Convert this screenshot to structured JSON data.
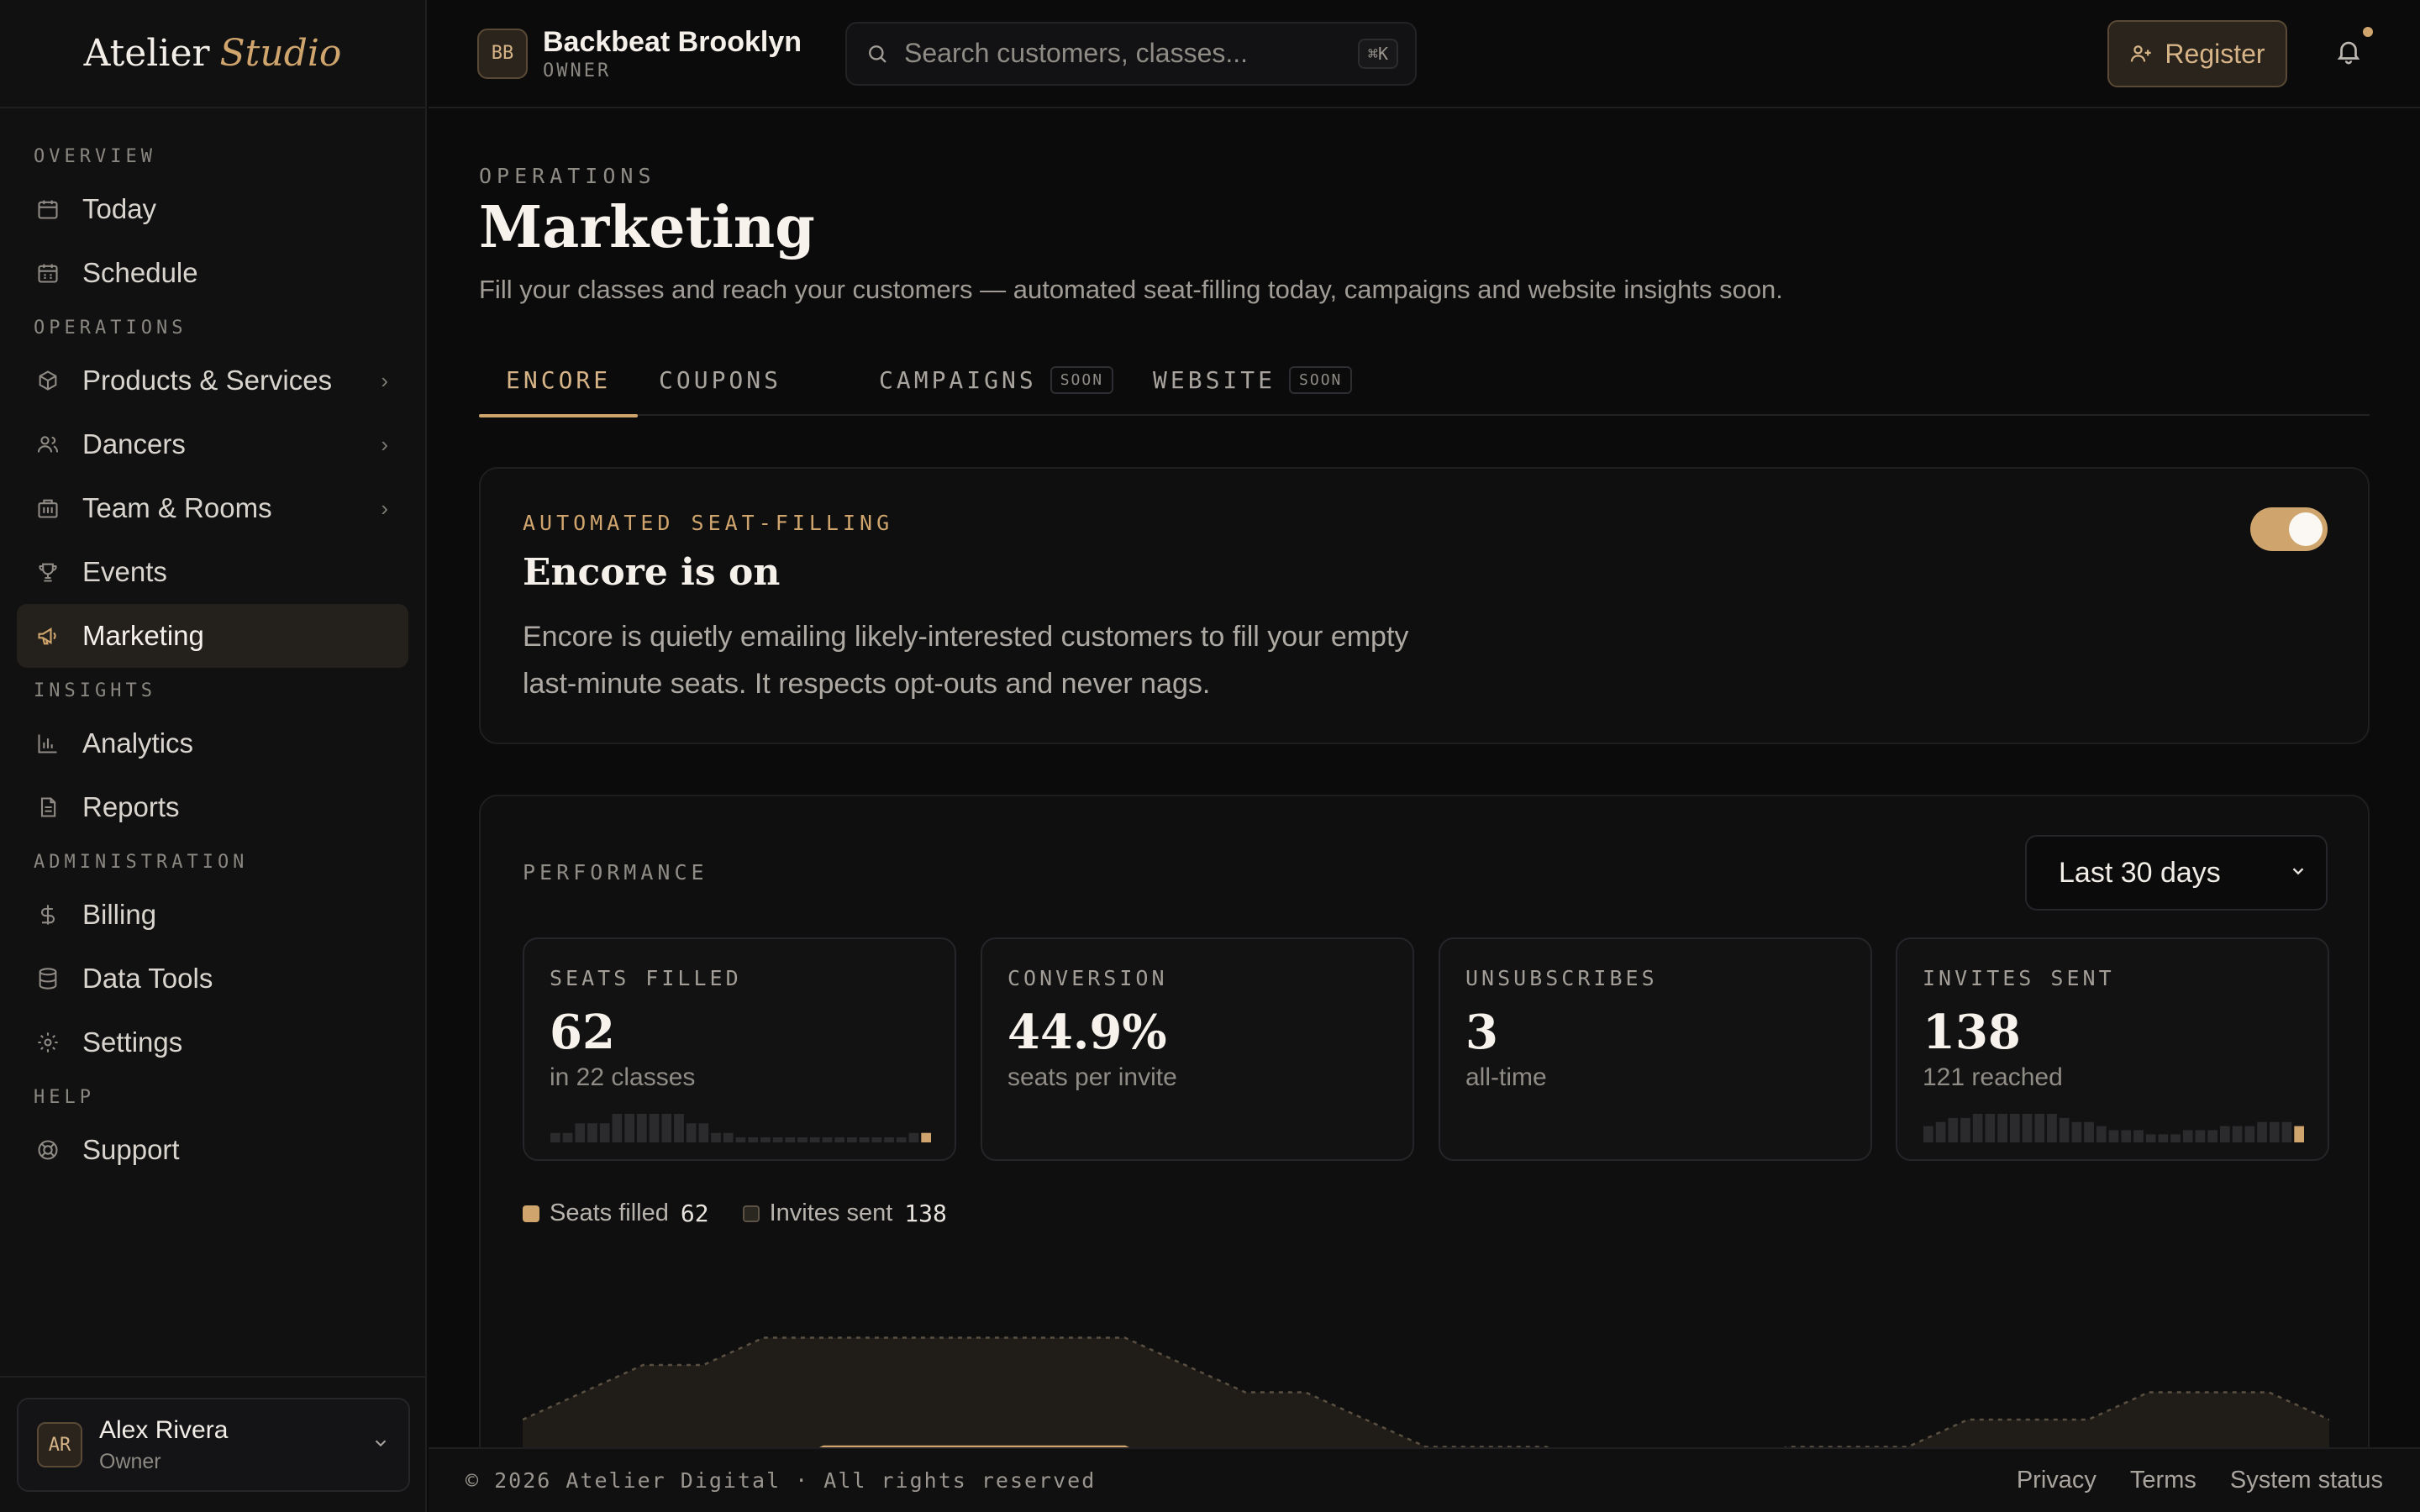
{
  "brand": {
    "name": "Atelier",
    "accent": "Studio"
  },
  "sidebar": {
    "sections": [
      {
        "title": "OVERVIEW",
        "items": [
          {
            "label": "Today",
            "icon": "calendar-icon"
          },
          {
            "label": "Schedule",
            "icon": "calendar-grid-icon"
          }
        ]
      },
      {
        "title": "OPERATIONS",
        "items": [
          {
            "label": "Products & Services",
            "icon": "box-icon"
          },
          {
            "label": "Dancers",
            "icon": "users-icon"
          },
          {
            "label": "Team & Rooms",
            "icon": "building-icon"
          },
          {
            "label": "Events",
            "icon": "trophy-icon"
          },
          {
            "label": "Marketing",
            "icon": "megaphone-icon"
          }
        ]
      },
      {
        "title": "INSIGHTS",
        "items": [
          {
            "label": "Analytics",
            "icon": "bar-chart-icon"
          },
          {
            "label": "Reports",
            "icon": "document-icon"
          }
        ]
      },
      {
        "title": "ADMINISTRATION",
        "items": [
          {
            "label": "Billing",
            "icon": "dollar-icon"
          },
          {
            "label": "Data Tools",
            "icon": "database-icon"
          },
          {
            "label": "Settings",
            "icon": "gear-icon"
          }
        ]
      },
      {
        "title": "HELP",
        "items": [
          {
            "label": "Support",
            "icon": "lifebuoy-icon"
          }
        ]
      }
    ],
    "user": {
      "initials": "AR",
      "name": "Alex Rivera",
      "role": "Owner"
    }
  },
  "topbar": {
    "org_initials": "BB",
    "org_name": "Backbeat Brooklyn",
    "org_role": "OWNER",
    "search_placeholder": "Search customers, classes...",
    "search_shortcut": "⌘K",
    "register_label": "Register"
  },
  "page": {
    "eyebrow": "OPERATIONS",
    "title": "Marketing",
    "subtitle": "Fill your classes and reach your customers — automated seat-filling today, campaigns and website insights soon.",
    "tabs": [
      {
        "label": "ENCORE",
        "soon": ""
      },
      {
        "label": "COUPONS",
        "soon": ""
      },
      {
        "label": "CAMPAIGNS",
        "soon": "SOON"
      },
      {
        "label": "WEBSITE",
        "soon": "SOON"
      }
    ]
  },
  "encore": {
    "eyebrow": "AUTOMATED SEAT-FILLING",
    "title": "Encore is on",
    "description": "Encore is quietly emailing likely-interested customers to fill your empty last-minute seats. It respects opt-outs and never nags.",
    "enabled": true
  },
  "performance": {
    "eyebrow": "PERFORMANCE",
    "range": "Last 30 days",
    "stats": [
      {
        "label": "SEATS FILLED",
        "value": "62",
        "sub": "in 22 classes"
      },
      {
        "label": "CONVERSION",
        "value": "44.9%",
        "sub": "seats per invite"
      },
      {
        "label": "UNSUBSCRIBES",
        "value": "3",
        "sub": "all-time"
      },
      {
        "label": "INVITES SENT",
        "value": "138",
        "sub": "121 reached"
      }
    ],
    "legend": [
      {
        "label": "Seats filled",
        "value": "62",
        "color": "#cfa56d"
      },
      {
        "label": "Invites sent",
        "value": "138",
        "color": "#2a2620"
      }
    ]
  },
  "footer": {
    "copyright": "© 2026 Atelier Digital · All rights reserved",
    "links": [
      "Privacy",
      "Terms",
      "System status"
    ]
  },
  "chart_data": {
    "type": "area",
    "series": [
      {
        "name": "Invites sent",
        "values": [
          4,
          5,
          6,
          6,
          7,
          7,
          7,
          7,
          7,
          7,
          7,
          6,
          5,
          5,
          4,
          3,
          3,
          3,
          2,
          2,
          2,
          3,
          3,
          3,
          4,
          4,
          4,
          5,
          5,
          5,
          4
        ]
      },
      {
        "name": "Seats filled",
        "values": [
          1,
          1,
          2,
          2,
          2,
          3,
          3,
          3,
          3,
          3,
          3,
          2,
          2,
          1,
          1,
          0,
          0,
          0,
          0,
          0,
          0,
          0,
          0,
          0,
          0,
          0,
          0,
          0,
          0,
          1,
          1
        ]
      }
    ]
  }
}
